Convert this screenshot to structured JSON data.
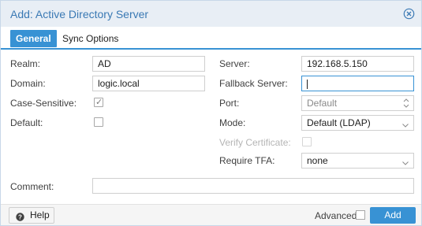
{
  "dialog": {
    "title": "Add: Active Directory Server"
  },
  "tabs": [
    {
      "label": "General",
      "active": true
    },
    {
      "label": "Sync Options",
      "active": false
    }
  ],
  "left": {
    "realm_label": "Realm:",
    "realm_value": "AD",
    "domain_label": "Domain:",
    "domain_value": "logic.local",
    "case_sensitive_label": "Case-Sensitive:",
    "case_sensitive_checked": true,
    "default_label": "Default:",
    "default_checked": false
  },
  "right": {
    "server_label": "Server:",
    "server_value": "192.168.5.150",
    "fallback_label": "Fallback Server:",
    "fallback_value": "",
    "port_label": "Port:",
    "port_placeholder": "Default",
    "mode_label": "Mode:",
    "mode_value": "Default (LDAP)",
    "verify_label": "Verify Certificate:",
    "require_tfa_label": "Require TFA:",
    "require_tfa_value": "none"
  },
  "comment": {
    "label": "Comment:",
    "value": ""
  },
  "footer": {
    "help_label": "Help",
    "advanced_label": "Advanced",
    "advanced_checked": false,
    "add_label": "Add"
  },
  "colors": {
    "accent": "#3892d4",
    "title": "#3a79b4",
    "header_bg": "#e8eef5",
    "footer_bg": "#f5f5f5"
  },
  "icons": {
    "close": "close-circle-icon",
    "help": "question-circle-icon",
    "dropdown": "chevron-down-icon",
    "spinner": "spinner-arrows-icon",
    "check": "checkmark-icon"
  }
}
